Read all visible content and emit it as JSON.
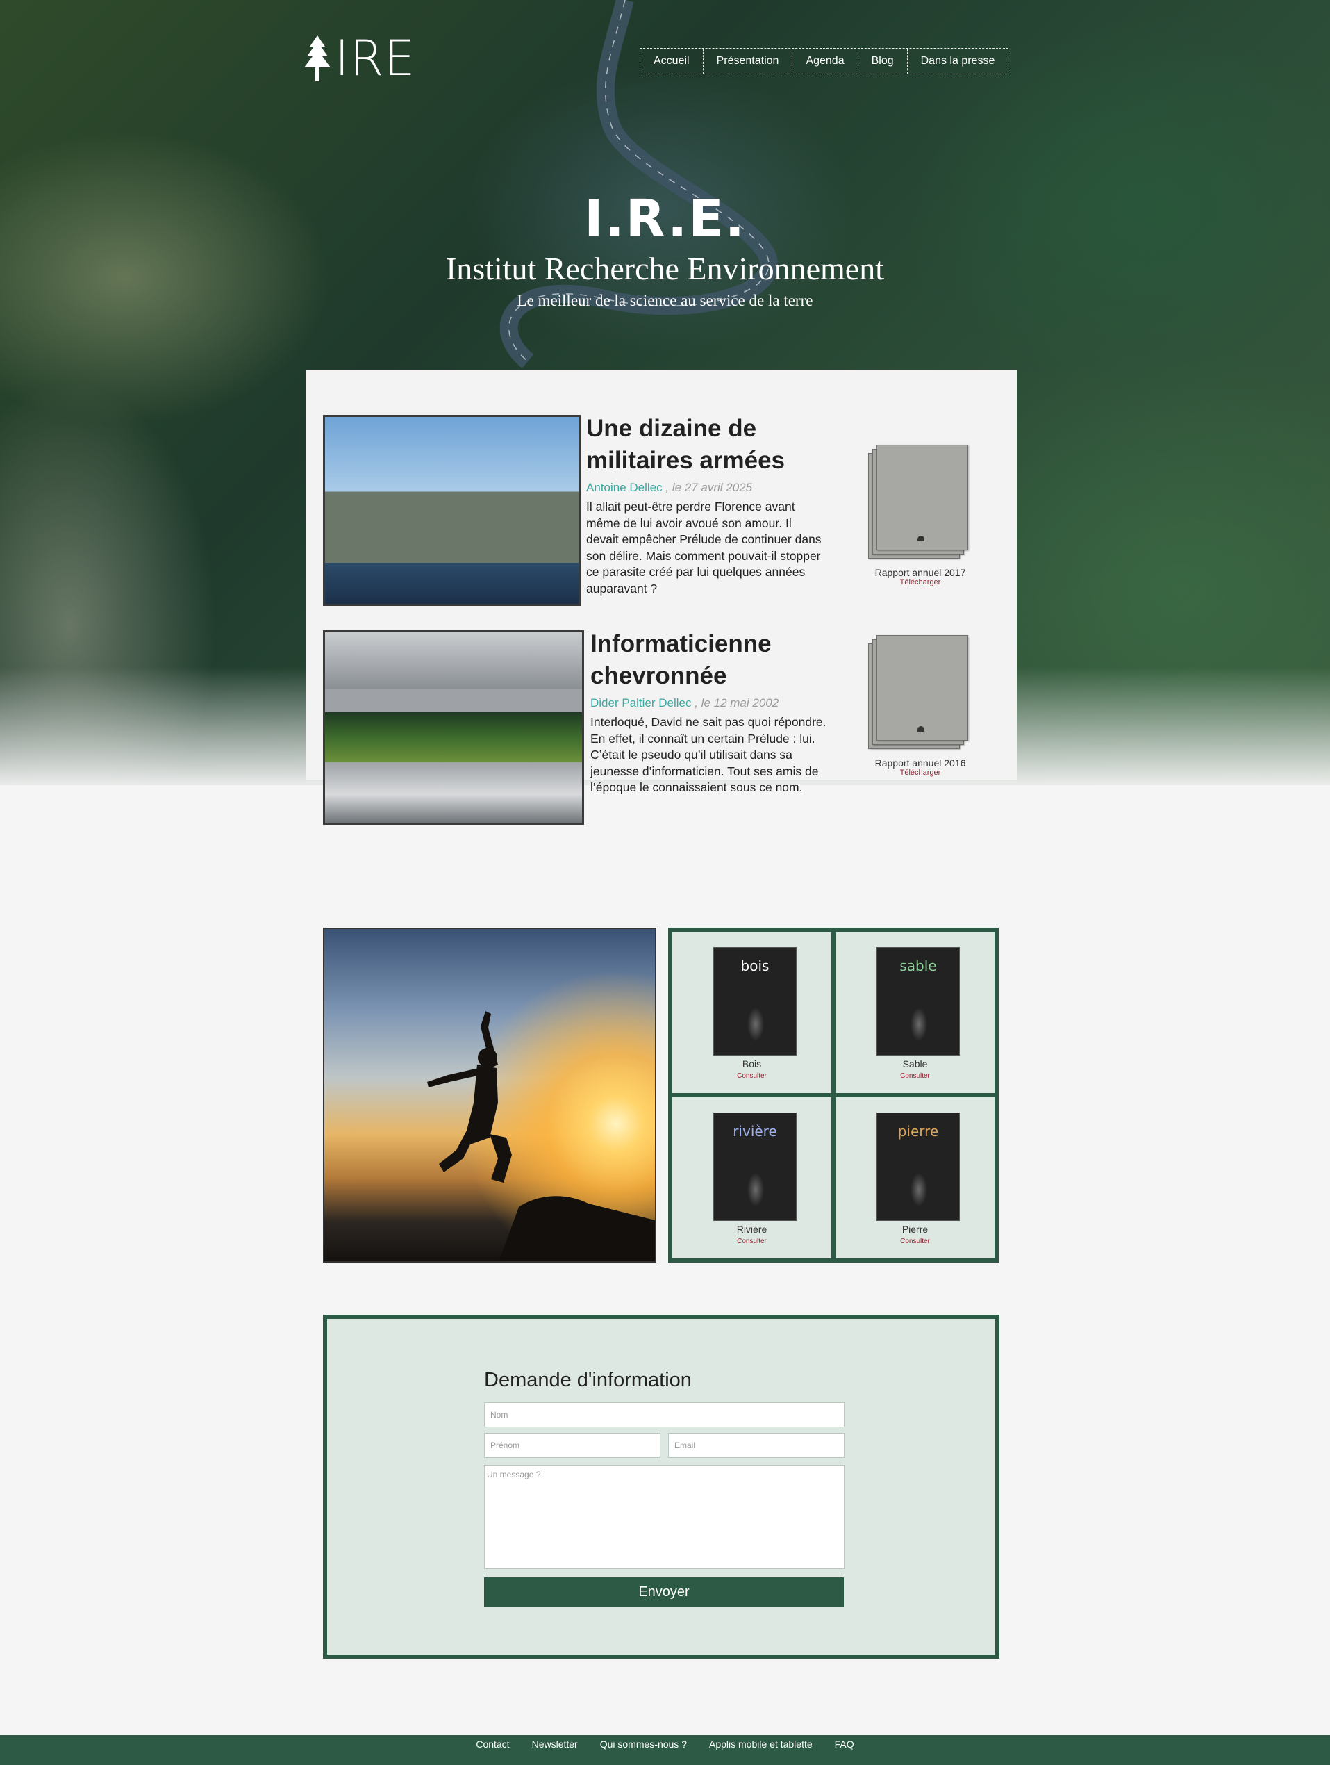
{
  "brand": {
    "logo_text": "IRE"
  },
  "nav": {
    "items": [
      {
        "label": "Accueil"
      },
      {
        "label": "Présentation"
      },
      {
        "label": "Agenda"
      },
      {
        "label": "Blog"
      },
      {
        "label": "Dans la presse"
      }
    ]
  },
  "hero": {
    "title": "I.R.E.",
    "subtitle": "Institut Recherche Environnement",
    "tagline": "Le meilleur de la science au service de la terre"
  },
  "articles": [
    {
      "title": "Une dizaine de militaires armées",
      "author": "Antoine Dellec",
      "date": ", le 27 avril 2025",
      "text": "Il allait peut-être perdre Florence avant même de lui avoir avoué son amour. Il devait empêcher Prélude de continuer dans son délire. Mais comment pouvait-il stopper ce parasite créé par lui quelques années auparavant ?"
    },
    {
      "title": "Informaticienne chevronnée",
      "author": "Dider Paltier Dellec",
      "date": ", le 12 mai 2002",
      "text": "Interloqué, David ne sait pas quoi répondre. En effet, il connaît un certain Prélude : lui. C’était le pseudo qu’il utilisait dans sa jeunesse d’informaticien. Tout ses amis de l’époque le connaissaient sous ce nom."
    }
  ],
  "reports": [
    {
      "name": "Rapport annuel 2017",
      "link": "Télécharger"
    },
    {
      "name": "Rapport annuel 2016",
      "link": "Télécharger"
    }
  ],
  "books": [
    {
      "cover_title": "bois",
      "name": "Bois",
      "link": "Consulter",
      "cover_color": "#ffffff"
    },
    {
      "cover_title": "sable",
      "name": "Sable",
      "link": "Consulter",
      "cover_color": "#8fd49a"
    },
    {
      "cover_title": "rivière",
      "name": "Rivière",
      "link": "Consulter",
      "cover_color": "#9fb2ee"
    },
    {
      "cover_title": "pierre",
      "name": "Pierre",
      "link": "Consulter",
      "cover_color": "#d9a25a"
    }
  ],
  "form": {
    "title": "Demande d'information",
    "nom_placeholder": "Nom",
    "prenom_placeholder": "Prénom",
    "email_placeholder": "Email",
    "message_placeholder": "Un message ?",
    "submit_label": "Envoyer"
  },
  "footer": {
    "links": [
      {
        "label": "Contact"
      },
      {
        "label": "Newsletter"
      },
      {
        "label": "Qui sommes-nous ?"
      },
      {
        "label": "Applis mobile et tablette"
      },
      {
        "label": "FAQ"
      }
    ]
  },
  "colors": {
    "brand_green": "#2d5a45",
    "light_green": "#dde8e2",
    "author_teal": "#3aa9a0",
    "link_red": "#9a2030"
  }
}
